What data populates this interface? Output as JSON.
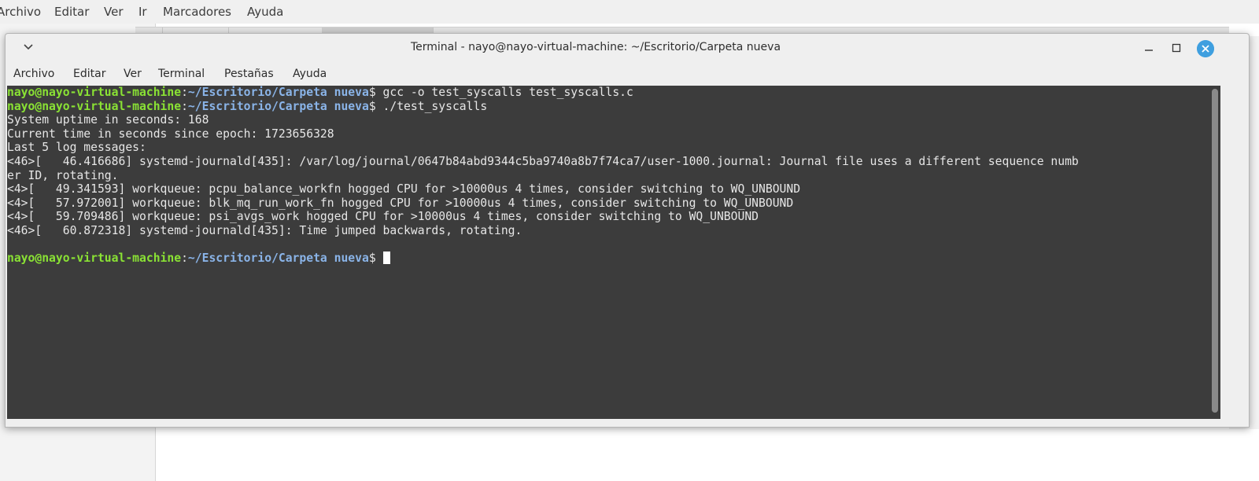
{
  "background_app": {
    "menu": [
      "Archivo",
      "Editar",
      "Ver",
      "Ir",
      "Marcadores",
      "Ayuda"
    ]
  },
  "window": {
    "title": "Terminal - nayo@nayo-virtual-machine: ~/Escritorio/Carpeta nueva",
    "menu": [
      "Archivo",
      "Editar",
      "Ver",
      "Terminal",
      "Pestañas",
      "Ayuda"
    ],
    "close_color": "#3f9fdf"
  },
  "terminal": {
    "colors": {
      "background": "#3c3c3c",
      "user": "#8ae234",
      "path": "#8ab4e8",
      "text": "#e6e6e6"
    },
    "prompt_user": "nayo@nayo-virtual-machine",
    "prompt_sep": ":",
    "prompt_path": "~/Escritorio/Carpeta nueva",
    "prompt_symbol": "$",
    "command1": " gcc -o test_syscalls test_syscalls.c",
    "command2": " ./test_syscalls",
    "output": [
      "System uptime in seconds: 168",
      "Current time in seconds since epoch: 1723656328",
      "Last 5 log messages:",
      "<46>[   46.416686] systemd-journald[435]: /var/log/journal/0647b84abd9344c5ba9740a8b7f74ca7/user-1000.journal: Journal file uses a different sequence numb",
      "er ID, rotating.",
      "<4>[   49.341593] workqueue: pcpu_balance_workfn hogged CPU for >10000us 4 times, consider switching to WQ_UNBOUND",
      "<4>[   57.972001] workqueue: blk_mq_run_work_fn hogged CPU for >10000us 4 times, consider switching to WQ_UNBOUND",
      "<4>[   59.709486] workqueue: psi_avgs_work hogged CPU for >10000us 4 times, consider switching to WQ_UNBOUND",
      "<46>[   60.872318] systemd-journald[435]: Time jumped backwards, rotating.",
      ""
    ]
  }
}
